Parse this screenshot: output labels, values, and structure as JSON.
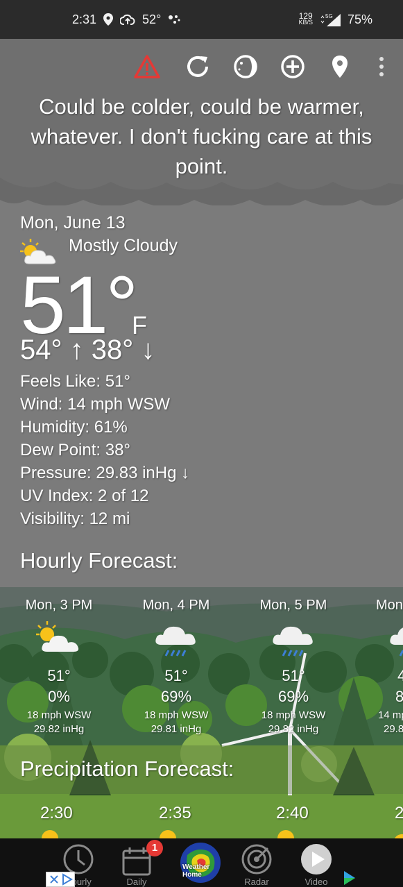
{
  "status_bar": {
    "time": "2:31",
    "temp": "52°",
    "net_speed": "129",
    "net_unit": "KB/S",
    "signal": "5G",
    "battery": "75%"
  },
  "toolbar": {
    "icons": [
      "alert-icon",
      "refresh-icon",
      "moon-phase-icon",
      "add-icon",
      "location-icon",
      "more-icon"
    ]
  },
  "quip": "Could be colder, could be warmer, whatever. I don't fucking care at this point.",
  "current": {
    "date": "Mon, June 13",
    "condition": "Mostly Cloudy",
    "temp": "51°",
    "unit": "F",
    "hi_lo": "54° ↑  38° ↓",
    "feels_like": "Feels Like:  51°",
    "wind": "Wind:  14 mph WSW",
    "humidity": "Humidity:  61%",
    "dew_point": "Dew Point:  38°",
    "pressure": "Pressure:  29.83 inHg ↓",
    "uv_index": "UV Index:  2 of 12",
    "visibility": "Visibility:  12 mi"
  },
  "hourly": {
    "title": "Hourly Forecast:",
    "items": [
      {
        "time": "Mon, 3 PM",
        "icon": "partly-cloudy-icon",
        "temp": "51°",
        "precip": "0%",
        "wind": "18 mph WSW",
        "pressure": "29.82 inHg"
      },
      {
        "time": "Mon, 4 PM",
        "icon": "rain-icon",
        "temp": "51°",
        "precip": "69%",
        "wind": "18 mph WSW",
        "pressure": "29.81 inHg"
      },
      {
        "time": "Mon, 5 PM",
        "icon": "rain-icon",
        "temp": "51°",
        "precip": "69%",
        "wind": "18 mph WSW",
        "pressure": "29.82 inHg"
      },
      {
        "time": "Mon",
        "icon": "rain-icon",
        "temp": "4",
        "precip": "8",
        "wind": "14 mp",
        "pressure": "29.8"
      }
    ]
  },
  "precip": {
    "title": "Precipitation Forecast:",
    "times": [
      "2:30",
      "2:35",
      "2:40",
      "2"
    ]
  },
  "nav": {
    "items": [
      {
        "label": "Hourly",
        "icon": "clock-icon"
      },
      {
        "label": "Daily",
        "icon": "calendar-icon",
        "badge": "1"
      },
      {
        "label": "Weather Home",
        "icon": "radar-globe-icon"
      },
      {
        "label": "Radar",
        "icon": "radar-icon"
      },
      {
        "label": "Video",
        "icon": "play-icon"
      }
    ]
  },
  "colors": {
    "alert": "#e53935",
    "sky_gray": "#7b7b7b",
    "status_bar": "#2b2b2b",
    "grass": "#6a9a3a",
    "rain": "#3d7fd6",
    "sun": "#f7c21a"
  }
}
